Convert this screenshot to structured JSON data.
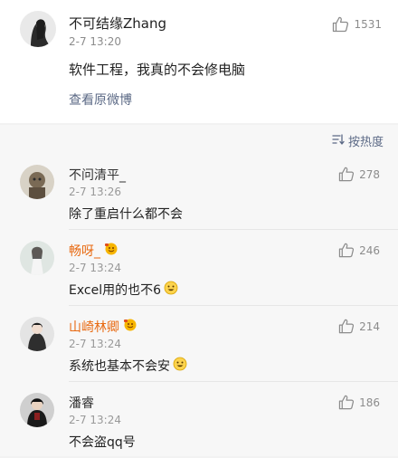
{
  "post": {
    "author": "不可结缘Zhang",
    "time": "2-7 13:20",
    "likes": "1531",
    "text": "软件工程，我真的不会修电脑",
    "view_original": "查看原微博"
  },
  "sort": {
    "label": "按热度"
  },
  "comments": [
    {
      "author": "不问清平_",
      "time": "2-7 13:26",
      "text": "除了重启什么都不会",
      "likes": "278"
    },
    {
      "author": "畅呀_",
      "time": "2-7 13:24",
      "text": "Excel用的也不6",
      "likes": "246"
    },
    {
      "author": "山崎林卿",
      "time": "2-7 13:24",
      "text": "系统也基本不会安",
      "likes": "214"
    },
    {
      "author": "潘睿",
      "time": "2-7 13:24",
      "text": "不会盗qq号",
      "likes": "186"
    }
  ],
  "colors": {
    "link": "#5c6a86",
    "vip_name": "#e86a12",
    "muted": "#999999"
  },
  "icons": [
    "thumbs-up-icon",
    "sort-icon",
    "vip-badge-icon",
    "grin-emoji-icon"
  ]
}
